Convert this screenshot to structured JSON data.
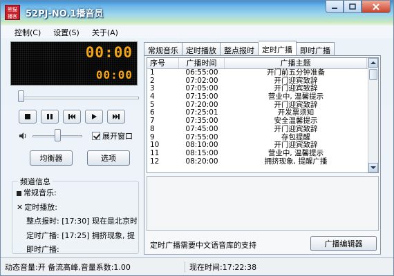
{
  "titlebar": {
    "app_icon_text": "熊猫播客",
    "title": "52PJ-NO.1播音员"
  },
  "menu": [
    "控制(C)",
    "设置(S)",
    "关于(A)"
  ],
  "player": {
    "time_main": "00:00",
    "time_sub": "00:00",
    "expand_window_label": "展开窗口",
    "expand_window_checked": true,
    "equalizer_label": "均衡器",
    "options_label": "选项"
  },
  "channel_info": {
    "title": "频道信息",
    "rows": [
      {
        "marker": "■",
        "text": "常规音乐:"
      },
      {
        "marker": "✕",
        "text": "定时播放:"
      },
      {
        "marker": "",
        "text": "整点报时: [17:30] 现在是北京时"
      },
      {
        "marker": "",
        "text": "定时广播: [17:25] 拥挤现象, 提"
      },
      {
        "marker": "",
        "text": "即时广播:"
      }
    ]
  },
  "tabs": [
    "常规音乐",
    "定时播放",
    "整点报时",
    "定时广播",
    "即时广播"
  ],
  "active_tab": 3,
  "table": {
    "headers": [
      "序号",
      "广播时间",
      "广播主题"
    ],
    "rows": [
      [
        "1",
        "06:55:00",
        "开门前五分钟准备"
      ],
      [
        "2",
        "07:02:00",
        "开门迎宾致辞"
      ],
      [
        "3",
        "07:05:00",
        "开门迎宾致辞"
      ],
      [
        "4",
        "07:15:00",
        "营业中, 温馨提示"
      ],
      [
        "5",
        "07:20:00",
        "开门迎宾致辞"
      ],
      [
        "6",
        "07:25:01",
        "开发票须知"
      ],
      [
        "7",
        "07:35:00",
        "安全温馨提示"
      ],
      [
        "8",
        "07:45:00",
        "开门迎宾致辞"
      ],
      [
        "9",
        "07:55:00",
        "存包提醒"
      ],
      [
        "10",
        "08:10:00",
        "开门迎宾致辞"
      ],
      [
        "11",
        "08:15:00",
        "营业中, 温馨提示"
      ],
      [
        "12",
        "08:20:00",
        "拥挤现象, 提醒广播"
      ]
    ]
  },
  "note": "定时广播需要中文语音库的支持",
  "editor_button": "广播编辑器",
  "status": {
    "left": "动态音量:开 备流高峰,音量系数:1.00",
    "right": "现在时间:17:22:38"
  }
}
